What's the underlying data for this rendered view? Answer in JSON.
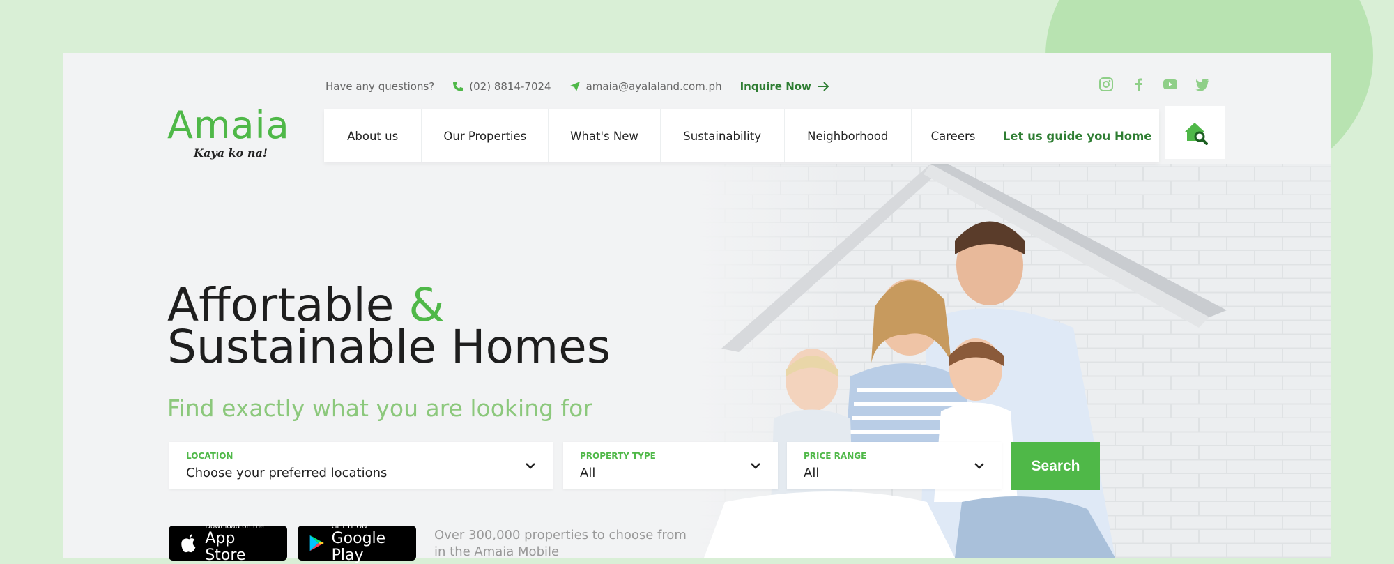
{
  "topbar": {
    "question": "Have  any questions?",
    "phone": "(02) 8814-7024",
    "email": "amaia@ayalaland.com.ph",
    "inquire": "Inquire Now"
  },
  "socials": [
    "instagram-icon",
    "facebook-icon",
    "youtube-icon",
    "twitter-icon"
  ],
  "logo": {
    "word": "Amaia",
    "tagline": "Kaya ko na!"
  },
  "nav": {
    "items": [
      {
        "label": "About us"
      },
      {
        "label": "Our Properties"
      },
      {
        "label": "What's New"
      },
      {
        "label": "Sustainability"
      },
      {
        "label": "Neighborhood"
      },
      {
        "label": "Careers"
      },
      {
        "label": "Let us guide you Home"
      }
    ]
  },
  "hero": {
    "line1": "Affortable",
    "amp": "&",
    "line2": "Sustainable Homes",
    "subhead": "Find exactly what you are looking for"
  },
  "search": {
    "location": {
      "label": "LOCATION",
      "value": "Choose your preferred locations"
    },
    "property_type": {
      "label": "PROPERTY TYPE",
      "value": "All"
    },
    "price_range": {
      "label": "PRICE RANGE",
      "value": "All"
    },
    "button": "Search"
  },
  "stores": {
    "apple": {
      "small": "Download on the",
      "big": "App Store"
    },
    "google": {
      "small": "GET IT ON",
      "big": "Google Play"
    }
  },
  "promo": "Over 300,000 properties to choose from in the Amaia Mobile",
  "colors": {
    "brand_green": "#4fb848",
    "dark_green": "#2e7d32",
    "subhead_green": "#8cc87c"
  }
}
